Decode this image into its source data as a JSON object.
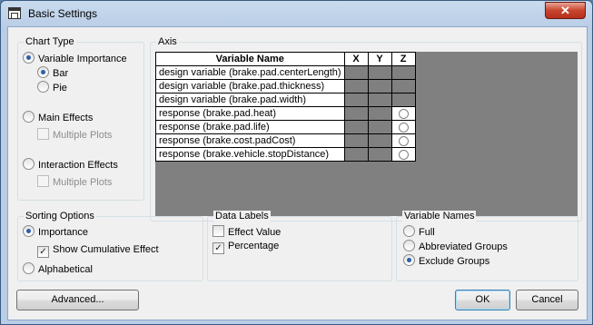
{
  "window": {
    "title": "Basic Settings",
    "close_glyph": "✕"
  },
  "chart_type": {
    "label": "Chart Type",
    "variable_importance": "Variable Importance",
    "bar": "Bar",
    "pie": "Pie",
    "main_effects": "Main Effects",
    "main_multiple_plots": "Multiple Plots",
    "interaction_effects": "Interaction Effects",
    "interaction_multiple_plots": "Multiple Plots"
  },
  "axis": {
    "label": "Axis",
    "columns": [
      "Variable Name",
      "X",
      "Y",
      "Z"
    ],
    "rows": [
      {
        "name": "design variable (brake.pad.centerLength)",
        "z_radio": false
      },
      {
        "name": "design variable (brake.pad.thickness)",
        "z_radio": false
      },
      {
        "name": "design variable (brake.pad.width)",
        "z_radio": false
      },
      {
        "name": "response (brake.pad.heat)",
        "z_radio": true
      },
      {
        "name": "response (brake.pad.life)",
        "z_radio": true
      },
      {
        "name": "response (brake.cost.padCost)",
        "z_radio": true
      },
      {
        "name": "response (brake.vehicle.stopDistance)",
        "z_radio": true
      }
    ]
  },
  "sorting": {
    "label": "Sorting Options",
    "importance": "Importance",
    "show_cumulative": "Show Cumulative Effect",
    "alphabetical": "Alphabetical"
  },
  "data_labels": {
    "label": "Data Labels",
    "effect_value": "Effect Value",
    "percentage": "Percentage"
  },
  "variable_names": {
    "label": "Variable Names",
    "full": "Full",
    "abbreviated": "Abbreviated Groups",
    "exclude": "Exclude Groups"
  },
  "buttons": {
    "advanced": "Advanced...",
    "ok": "OK",
    "cancel": "Cancel"
  },
  "check_glyph": "✓"
}
